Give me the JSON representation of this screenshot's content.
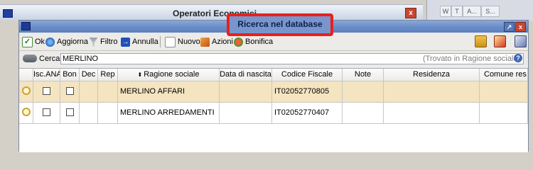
{
  "background_window": {
    "title": "Operatori Economici",
    "close_label": "x",
    "toolbar_letters": [
      "W",
      "T",
      "A...",
      "S..."
    ]
  },
  "dialog": {
    "title": "Ricerca nel database",
    "restore_label": "↗",
    "close_label": "x",
    "highlight_color": "#e8201b",
    "toolbar": {
      "ok": "Ok",
      "aggiorna": "Aggiorna",
      "filtro": "Filtro",
      "annulla": "Annulla",
      "nuovo": "Nuovo",
      "azioni": "Azioni",
      "bonifica": "Bonifica"
    },
    "search": {
      "label": "Cerca",
      "value": "MERLINO",
      "status": "(Trovato in Ragione sociale)",
      "help": "?"
    },
    "grid": {
      "columns": [
        "Isc.ANA",
        "Bon",
        "Dec",
        "Rep",
        "Ragione sociale",
        "Data di nascita",
        "Codice Fiscale",
        "Note",
        "Residenza",
        "Comune res"
      ],
      "sort_indicator": "⬍",
      "rows": [
        {
          "ragione_sociale": "MERLINO AFFARI",
          "data_nascita": "",
          "codice_fiscale": "IT02052770805",
          "note": "",
          "residenza": "",
          "comune": "",
          "selected": true
        },
        {
          "ragione_sociale": "MERLINO ARREDAMENTI",
          "data_nascita": "",
          "codice_fiscale": "IT02052770407",
          "note": "",
          "residenza": "",
          "comune": "",
          "selected": false
        }
      ]
    }
  }
}
